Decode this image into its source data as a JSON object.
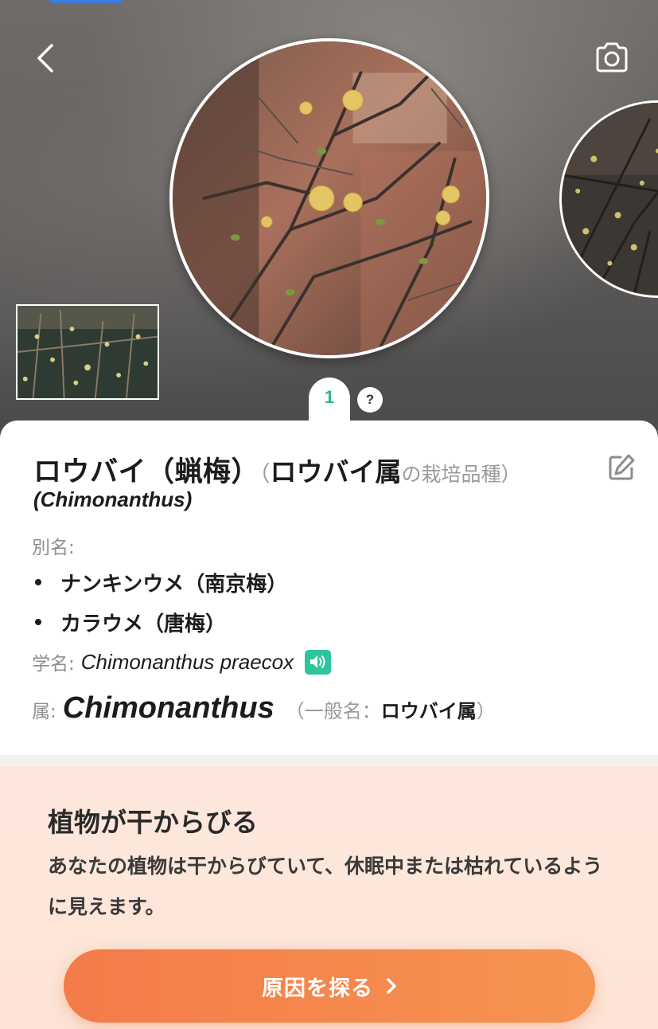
{
  "hero": {
    "page_indicator": "1",
    "help_label": "?"
  },
  "plant": {
    "common_name": "ロウバイ（蝋梅）",
    "paren_open": "（",
    "genus_common": "ロウバイ属",
    "genus_suffix": "の栽培品種）",
    "genus_latin_paren": "(Chimonanthus)",
    "alias_label": "別名:",
    "aliases": [
      "ナンキンウメ（南京梅）",
      "カラウメ（唐梅）"
    ],
    "scientific_label": "学名:",
    "scientific_name": "Chimonanthus praecox",
    "genus_label": "属:",
    "genus_name": "Chimonanthus",
    "genus_common_prefix": "（一般名：",
    "genus_common_name": "ロウバイ属",
    "genus_common_suffix": "）"
  },
  "alert": {
    "title": "植物が干からびる",
    "body": "あなたの植物は干からびていて、休眠中または枯れているように見えます。",
    "cta_label": "原因を探る"
  },
  "colors": {
    "accent_green": "#2bb58a",
    "speaker_green": "#2fc4a0",
    "cta_orange": "#f47b4a",
    "alert_bg": "#fde7dc"
  },
  "icons": {
    "back": "chevron-left-icon",
    "camera": "camera-icon",
    "edit": "edit-icon",
    "speaker": "speaker-icon",
    "cta": "chevron-right-icon"
  }
}
